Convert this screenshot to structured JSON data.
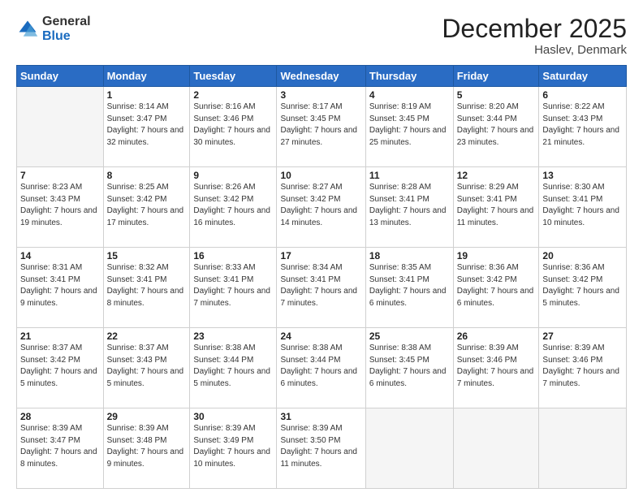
{
  "logo": {
    "general": "General",
    "blue": "Blue"
  },
  "header": {
    "title": "December 2025",
    "subtitle": "Haslev, Denmark"
  },
  "weekdays": [
    "Sunday",
    "Monday",
    "Tuesday",
    "Wednesday",
    "Thursday",
    "Friday",
    "Saturday"
  ],
  "weeks": [
    [
      {
        "day": "",
        "sunrise": "",
        "sunset": "",
        "daylight": ""
      },
      {
        "day": "1",
        "sunrise": "Sunrise: 8:14 AM",
        "sunset": "Sunset: 3:47 PM",
        "daylight": "Daylight: 7 hours and 32 minutes."
      },
      {
        "day": "2",
        "sunrise": "Sunrise: 8:16 AM",
        "sunset": "Sunset: 3:46 PM",
        "daylight": "Daylight: 7 hours and 30 minutes."
      },
      {
        "day": "3",
        "sunrise": "Sunrise: 8:17 AM",
        "sunset": "Sunset: 3:45 PM",
        "daylight": "Daylight: 7 hours and 27 minutes."
      },
      {
        "day": "4",
        "sunrise": "Sunrise: 8:19 AM",
        "sunset": "Sunset: 3:45 PM",
        "daylight": "Daylight: 7 hours and 25 minutes."
      },
      {
        "day": "5",
        "sunrise": "Sunrise: 8:20 AM",
        "sunset": "Sunset: 3:44 PM",
        "daylight": "Daylight: 7 hours and 23 minutes."
      },
      {
        "day": "6",
        "sunrise": "Sunrise: 8:22 AM",
        "sunset": "Sunset: 3:43 PM",
        "daylight": "Daylight: 7 hours and 21 minutes."
      }
    ],
    [
      {
        "day": "7",
        "sunrise": "Sunrise: 8:23 AM",
        "sunset": "Sunset: 3:43 PM",
        "daylight": "Daylight: 7 hours and 19 minutes."
      },
      {
        "day": "8",
        "sunrise": "Sunrise: 8:25 AM",
        "sunset": "Sunset: 3:42 PM",
        "daylight": "Daylight: 7 hours and 17 minutes."
      },
      {
        "day": "9",
        "sunrise": "Sunrise: 8:26 AM",
        "sunset": "Sunset: 3:42 PM",
        "daylight": "Daylight: 7 hours and 16 minutes."
      },
      {
        "day": "10",
        "sunrise": "Sunrise: 8:27 AM",
        "sunset": "Sunset: 3:42 PM",
        "daylight": "Daylight: 7 hours and 14 minutes."
      },
      {
        "day": "11",
        "sunrise": "Sunrise: 8:28 AM",
        "sunset": "Sunset: 3:41 PM",
        "daylight": "Daylight: 7 hours and 13 minutes."
      },
      {
        "day": "12",
        "sunrise": "Sunrise: 8:29 AM",
        "sunset": "Sunset: 3:41 PM",
        "daylight": "Daylight: 7 hours and 11 minutes."
      },
      {
        "day": "13",
        "sunrise": "Sunrise: 8:30 AM",
        "sunset": "Sunset: 3:41 PM",
        "daylight": "Daylight: 7 hours and 10 minutes."
      }
    ],
    [
      {
        "day": "14",
        "sunrise": "Sunrise: 8:31 AM",
        "sunset": "Sunset: 3:41 PM",
        "daylight": "Daylight: 7 hours and 9 minutes."
      },
      {
        "day": "15",
        "sunrise": "Sunrise: 8:32 AM",
        "sunset": "Sunset: 3:41 PM",
        "daylight": "Daylight: 7 hours and 8 minutes."
      },
      {
        "day": "16",
        "sunrise": "Sunrise: 8:33 AM",
        "sunset": "Sunset: 3:41 PM",
        "daylight": "Daylight: 7 hours and 7 minutes."
      },
      {
        "day": "17",
        "sunrise": "Sunrise: 8:34 AM",
        "sunset": "Sunset: 3:41 PM",
        "daylight": "Daylight: 7 hours and 7 minutes."
      },
      {
        "day": "18",
        "sunrise": "Sunrise: 8:35 AM",
        "sunset": "Sunset: 3:41 PM",
        "daylight": "Daylight: 7 hours and 6 minutes."
      },
      {
        "day": "19",
        "sunrise": "Sunrise: 8:36 AM",
        "sunset": "Sunset: 3:42 PM",
        "daylight": "Daylight: 7 hours and 6 minutes."
      },
      {
        "day": "20",
        "sunrise": "Sunrise: 8:36 AM",
        "sunset": "Sunset: 3:42 PM",
        "daylight": "Daylight: 7 hours and 5 minutes."
      }
    ],
    [
      {
        "day": "21",
        "sunrise": "Sunrise: 8:37 AM",
        "sunset": "Sunset: 3:42 PM",
        "daylight": "Daylight: 7 hours and 5 minutes."
      },
      {
        "day": "22",
        "sunrise": "Sunrise: 8:37 AM",
        "sunset": "Sunset: 3:43 PM",
        "daylight": "Daylight: 7 hours and 5 minutes."
      },
      {
        "day": "23",
        "sunrise": "Sunrise: 8:38 AM",
        "sunset": "Sunset: 3:44 PM",
        "daylight": "Daylight: 7 hours and 5 minutes."
      },
      {
        "day": "24",
        "sunrise": "Sunrise: 8:38 AM",
        "sunset": "Sunset: 3:44 PM",
        "daylight": "Daylight: 7 hours and 6 minutes."
      },
      {
        "day": "25",
        "sunrise": "Sunrise: 8:38 AM",
        "sunset": "Sunset: 3:45 PM",
        "daylight": "Daylight: 7 hours and 6 minutes."
      },
      {
        "day": "26",
        "sunrise": "Sunrise: 8:39 AM",
        "sunset": "Sunset: 3:46 PM",
        "daylight": "Daylight: 7 hours and 7 minutes."
      },
      {
        "day": "27",
        "sunrise": "Sunrise: 8:39 AM",
        "sunset": "Sunset: 3:46 PM",
        "daylight": "Daylight: 7 hours and 7 minutes."
      }
    ],
    [
      {
        "day": "28",
        "sunrise": "Sunrise: 8:39 AM",
        "sunset": "Sunset: 3:47 PM",
        "daylight": "Daylight: 7 hours and 8 minutes."
      },
      {
        "day": "29",
        "sunrise": "Sunrise: 8:39 AM",
        "sunset": "Sunset: 3:48 PM",
        "daylight": "Daylight: 7 hours and 9 minutes."
      },
      {
        "day": "30",
        "sunrise": "Sunrise: 8:39 AM",
        "sunset": "Sunset: 3:49 PM",
        "daylight": "Daylight: 7 hours and 10 minutes."
      },
      {
        "day": "31",
        "sunrise": "Sunrise: 8:39 AM",
        "sunset": "Sunset: 3:50 PM",
        "daylight": "Daylight: 7 hours and 11 minutes."
      },
      {
        "day": "",
        "sunrise": "",
        "sunset": "",
        "daylight": ""
      },
      {
        "day": "",
        "sunrise": "",
        "sunset": "",
        "daylight": ""
      },
      {
        "day": "",
        "sunrise": "",
        "sunset": "",
        "daylight": ""
      }
    ]
  ]
}
